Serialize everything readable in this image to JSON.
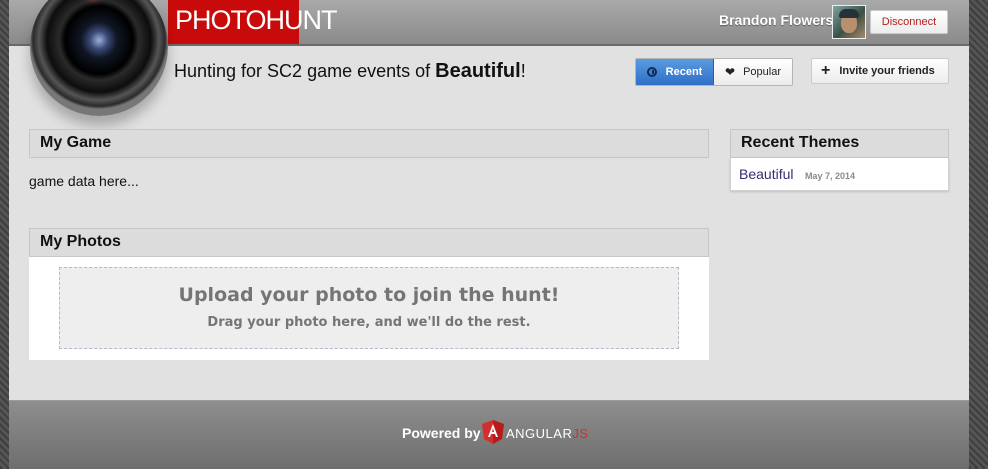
{
  "header": {
    "brand": "PHOTOHUNT",
    "user_name": "Brandon Flowers",
    "disconnect_label": "Disconnect"
  },
  "tagline": {
    "prefix": "Hunting for SC2 game events of ",
    "theme": "Beautiful",
    "suffix": "!"
  },
  "sort": {
    "recent_label": "Recent",
    "popular_label": "Popular",
    "active": "Recent"
  },
  "invite_label": "Invite your friends",
  "my_game": {
    "title": "My Game",
    "content": "game data here..."
  },
  "my_photos": {
    "title": "My Photos",
    "upload_title": "Upload your photo to join the hunt!",
    "upload_subtitle": "Drag your photo here, and we'll do the rest."
  },
  "recent_themes": {
    "title": "Recent Themes",
    "items": [
      {
        "name": "Beautiful",
        "date": "May 7, 2014"
      }
    ]
  },
  "footer": {
    "powered_by": "Powered by",
    "framework_main": "ANGULAR",
    "framework_js": "JS"
  },
  "colors": {
    "brand_red": "#c90a0a",
    "active_blue": "#3b7dd8",
    "theme_link": "#3d2a73"
  }
}
